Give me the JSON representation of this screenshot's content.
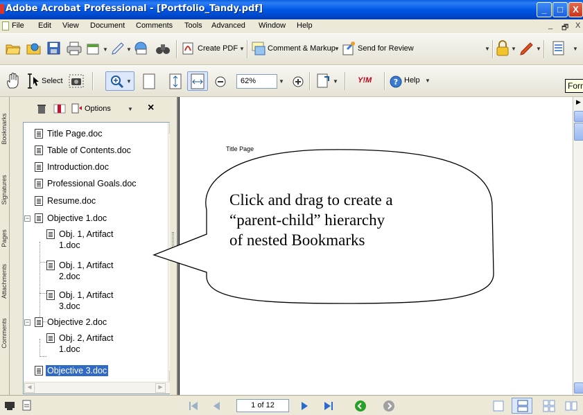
{
  "window": {
    "title": "Adobe Acrobat Professional - [Portfolio_Tandy.pdf]",
    "minimize": "_",
    "maximize": "□",
    "close": "X"
  },
  "menu": {
    "items": [
      "File",
      "Edit",
      "View",
      "Document",
      "Comments",
      "Tools",
      "Advanced",
      "Window",
      "Help"
    ],
    "mdi_minimize": "_",
    "mdi_restore": "🗗",
    "mdi_close": "X"
  },
  "toolbar1": {
    "create_pdf": "Create PDF",
    "comment_markup": "Comment & Markup",
    "send_for_review": "Send for Review"
  },
  "toolbar2": {
    "select": "Select",
    "zoom": "62%",
    "help": "Help",
    "yahoo": "Y!M",
    "tooltip": "Form"
  },
  "bookmarks": {
    "options": "Options",
    "close": "×",
    "items": [
      {
        "label": "Title Page.doc"
      },
      {
        "label": "Table of Contents.doc"
      },
      {
        "label": "Introduction.doc"
      },
      {
        "label": "Professional Goals.doc"
      },
      {
        "label": "Resume.doc"
      },
      {
        "label": "Objective 1.doc",
        "expander": "−"
      },
      {
        "label_line1": "Obj. 1, Artifact",
        "label_line2": "1.doc"
      },
      {
        "label_line1": "Obj. 1, Artifact",
        "label_line2": "2.doc"
      },
      {
        "label_line1": "Obj. 1, Artifact",
        "label_line2": "3.doc"
      },
      {
        "label": "Objective 2.doc",
        "expander": "−"
      },
      {
        "label_line1": "Obj. 2, Artifact",
        "label_line2": "1.doc"
      },
      {
        "label": "Objective 3.doc",
        "selected": true
      }
    ]
  },
  "nav_tabs": [
    "Bookmarks",
    "Signatures",
    "Pages",
    "Attachments",
    "Comments"
  ],
  "document": {
    "page_title": "Title Page"
  },
  "status": {
    "page": "1 of 12"
  },
  "callout": {
    "line1": "Click and drag to create a",
    "line2": "“parent-child” hierarchy",
    "line3": "of nested Bookmarks"
  }
}
